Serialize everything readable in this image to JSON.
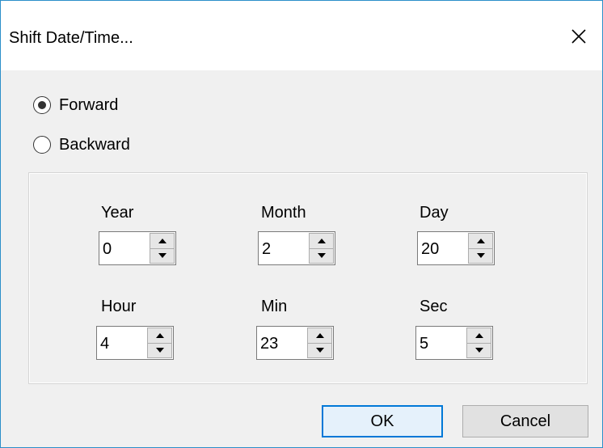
{
  "dialog": {
    "title": "Shift Date/Time...",
    "close_icon": "close-icon"
  },
  "direction": {
    "selected": "Forward",
    "options": [
      "Forward",
      "Backward"
    ]
  },
  "fields": {
    "year": {
      "label": "Year",
      "value": "0"
    },
    "month": {
      "label": "Month",
      "value": "2"
    },
    "day": {
      "label": "Day",
      "value": "20"
    },
    "hour": {
      "label": "Hour",
      "value": "4"
    },
    "min": {
      "label": "Min",
      "value": "23"
    },
    "sec": {
      "label": "Sec",
      "value": "5"
    }
  },
  "buttons": {
    "ok": "OK",
    "cancel": "Cancel"
  },
  "colors": {
    "window_border": "#2b8fc9",
    "default_button_border": "#0078d7",
    "dialog_background": "#f0f0f0"
  }
}
